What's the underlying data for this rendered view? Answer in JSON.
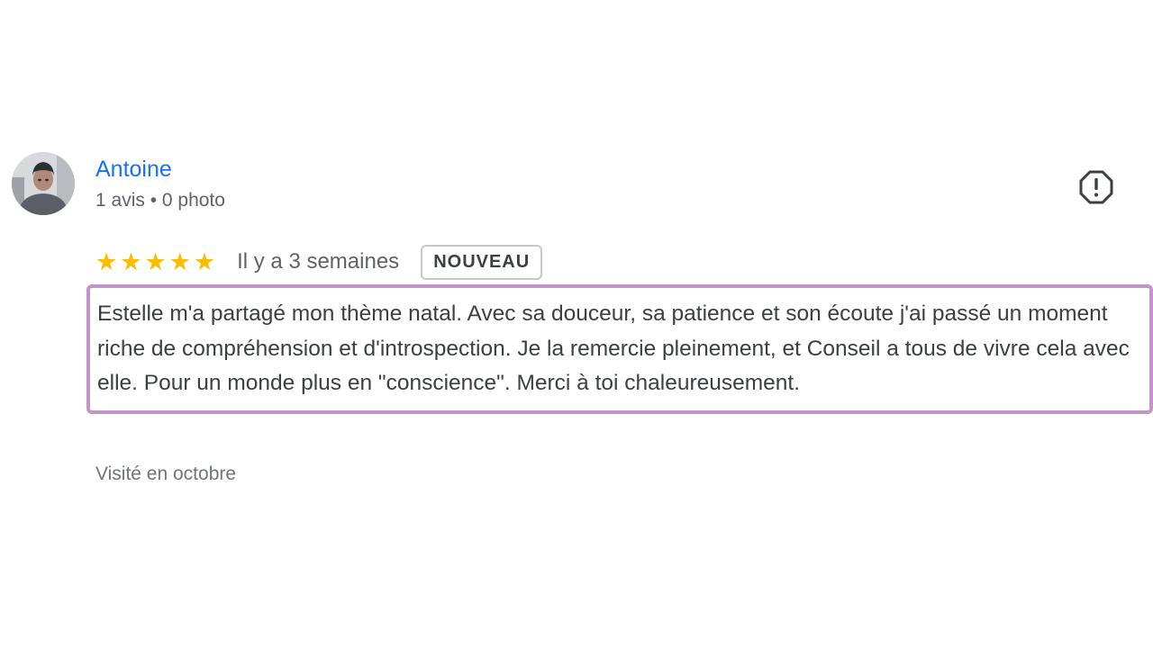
{
  "review": {
    "author": {
      "name": "Antoine",
      "meta": "1 avis • 0 photo"
    },
    "rating": {
      "stars": 5,
      "max": 5,
      "star_glyph": "★",
      "color": "#fbbc04"
    },
    "date": "Il y a 3 semaines",
    "badge": "NOUVEAU",
    "text": "Estelle m'a partagé mon thème natal. Avec sa douceur, sa patience et son écoute j'ai passé un moment riche de compréhension et d'introspection. Je la remercie pleinement, et Conseil a tous de vivre cela avec elle. Pour un monde plus en \"conscience\". Merci à toi chaleureusement.",
    "visit": "Visité en octobre",
    "highlight_color": "#c395c6",
    "link_color": "#1a73e8",
    "icons": {
      "report": "report-flag-icon",
      "star": "star-icon",
      "avatar": "avatar"
    }
  }
}
